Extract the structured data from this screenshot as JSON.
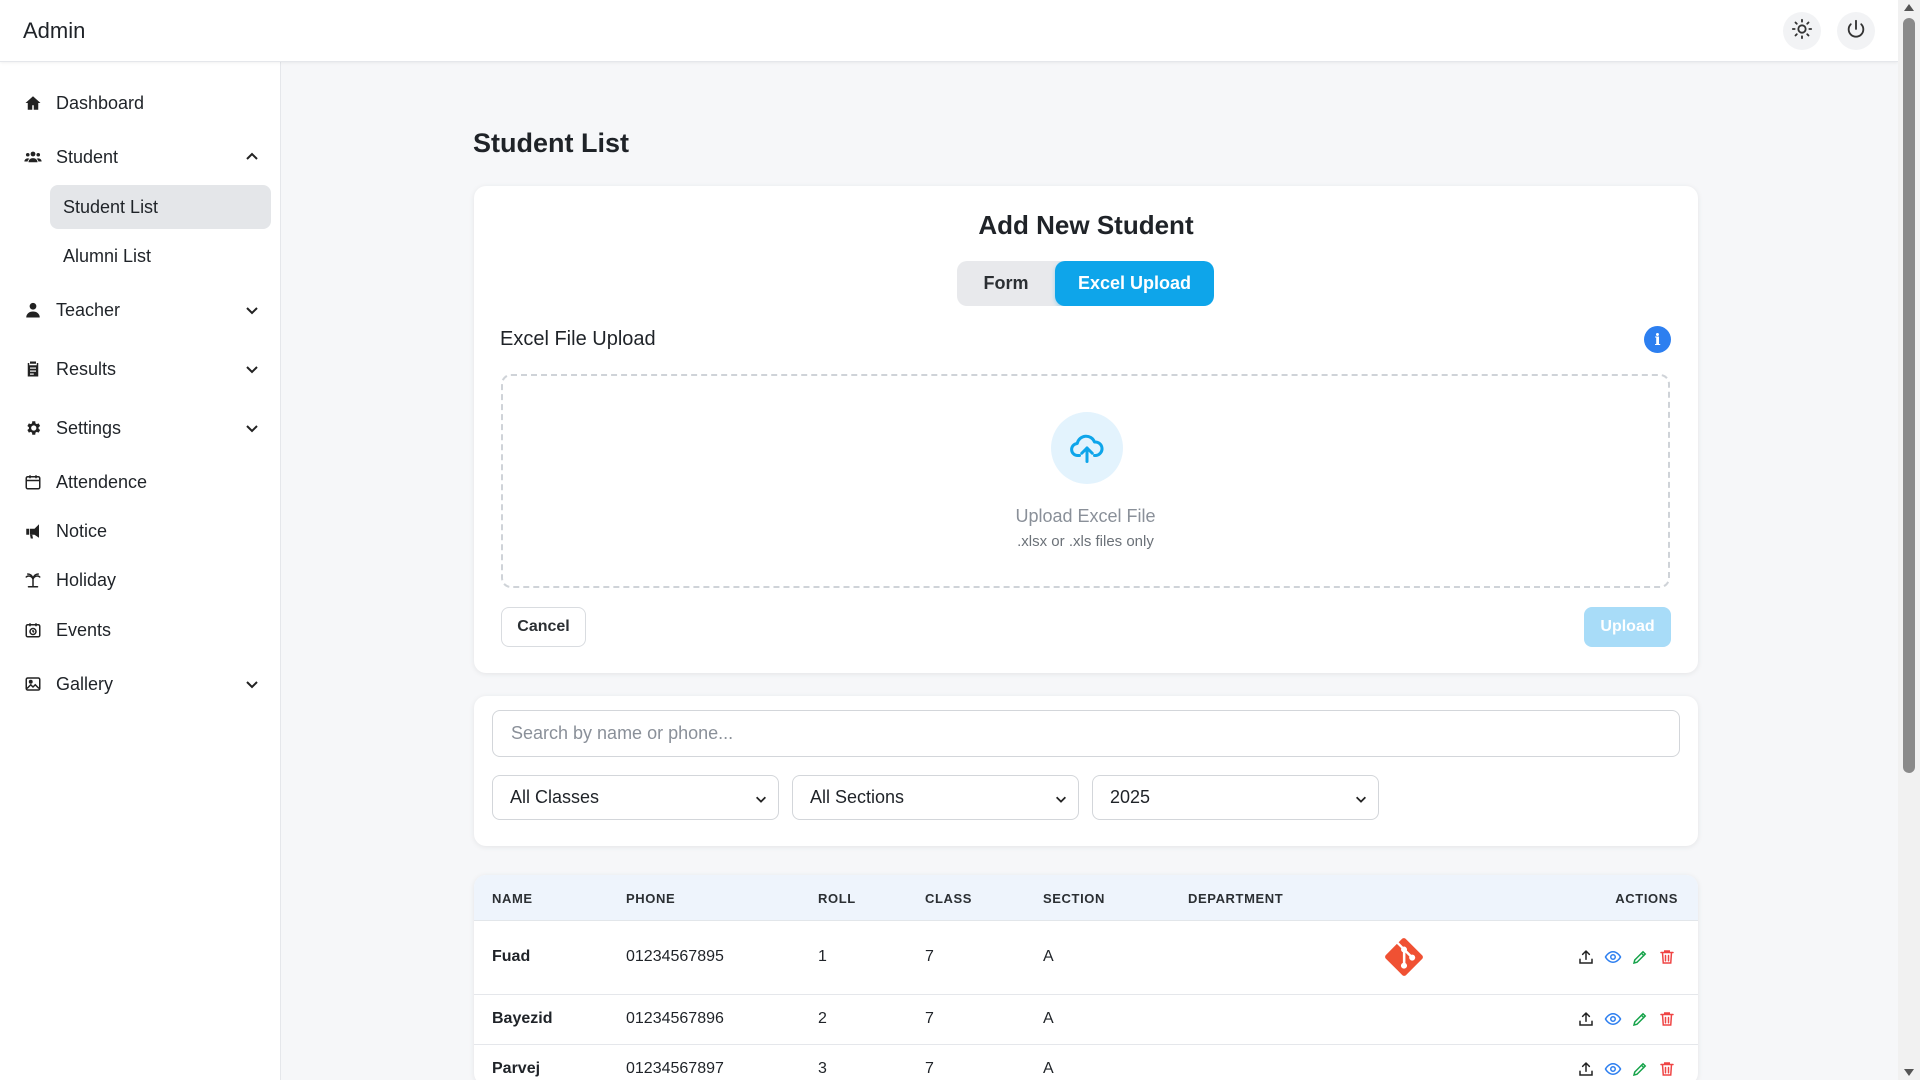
{
  "header": {
    "brand": "Admin",
    "theme_icon": "sun-icon",
    "logout_icon": "power-icon"
  },
  "sidebar": {
    "items": [
      {
        "label": "Dashboard",
        "icon": "home-icon"
      },
      {
        "label": "Student",
        "icon": "users-icon",
        "expanded": true
      },
      {
        "label": "Teacher",
        "icon": "user-icon"
      },
      {
        "label": "Results",
        "icon": "clipboard-icon"
      },
      {
        "label": "Settings",
        "icon": "gear-icon"
      },
      {
        "label": "Attendence",
        "icon": "calendar-icon"
      },
      {
        "label": "Notice",
        "icon": "megaphone-icon"
      },
      {
        "label": "Holiday",
        "icon": "palm-tree-icon"
      },
      {
        "label": "Events",
        "icon": "calendar-clock-icon"
      },
      {
        "label": "Gallery",
        "icon": "image-icon"
      }
    ],
    "student_sub": [
      {
        "label": "Student List",
        "active": true
      },
      {
        "label": "Alumni List"
      }
    ]
  },
  "main": {
    "page_title": "Student List",
    "add_card": {
      "title": "Add New Student",
      "tabs": [
        {
          "label": "Form",
          "active": false
        },
        {
          "label": "Excel Upload",
          "active": true
        }
      ],
      "section_label": "Excel File Upload",
      "info_label": "i",
      "dropzone": {
        "main": "Upload Excel File",
        "sub": ".xlsx or .xls files only"
      },
      "cancel_label": "Cancel",
      "upload_label": "Upload"
    },
    "filters": {
      "search_placeholder": "Search by name or phone...",
      "class_value": "All Classes",
      "section_value": "All Sections",
      "year_value": "2025"
    },
    "table": {
      "columns": [
        "NAME",
        "PHONE",
        "ROLL",
        "CLASS",
        "SECTION",
        "DEPARTMENT",
        "ACTIONS"
      ],
      "rows": [
        {
          "name": "Fuad",
          "phone": "01234567895",
          "roll": "1",
          "class": "7",
          "section": "A",
          "department": ""
        },
        {
          "name": "Bayezid",
          "phone": "01234567896",
          "roll": "2",
          "class": "7",
          "section": "A",
          "department": ""
        },
        {
          "name": "Parvej",
          "phone": "01234567897",
          "roll": "3",
          "class": "7",
          "section": "A",
          "department": ""
        }
      ]
    }
  },
  "colors": {
    "accent": "#0ea5ea",
    "info": "#2d7ff0",
    "upload_disabled": "#a8dcf8",
    "view": "#2d7ff0",
    "edit": "#16a34a",
    "delete": "#ef4444",
    "git": "#f05133"
  }
}
